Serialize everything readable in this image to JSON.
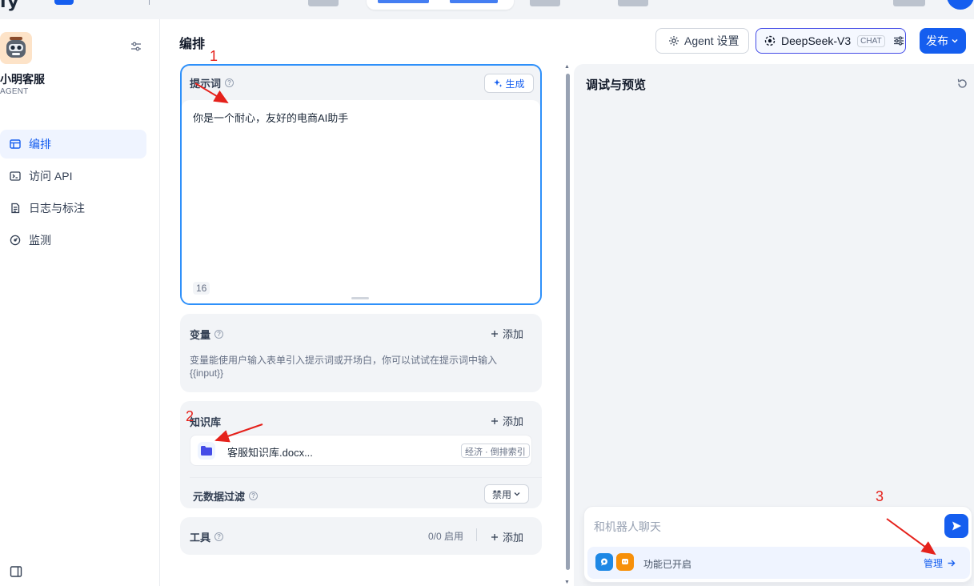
{
  "app": {
    "name": "小明客服",
    "type": "AGENT"
  },
  "sidebar": {
    "items": [
      {
        "label": "编排",
        "icon": "layout-icon",
        "active": true
      },
      {
        "label": "访问 API",
        "icon": "terminal-icon",
        "active": false
      },
      {
        "label": "日志与标注",
        "icon": "document-icon",
        "active": false
      },
      {
        "label": "监测",
        "icon": "gauge-icon",
        "active": false
      }
    ]
  },
  "header": {
    "title": "编排",
    "agent_settings_label": "Agent 设置",
    "model_name": "DeepSeek-V3",
    "model_tag": "CHAT",
    "publish_label": "发布"
  },
  "prompt": {
    "title": "提示词",
    "generate_label": "生成",
    "text": "你是一个耐心，友好的电商AI助手",
    "char_count": "16"
  },
  "variables": {
    "title": "变量",
    "add_label": "添加",
    "description": "变量能使用户输入表单引入提示词或开场白，你可以试试在提示词中输入 {{input}}"
  },
  "knowledge": {
    "title": "知识库",
    "add_label": "添加",
    "item_name": "客服知识库.docx...",
    "item_tag": "经济 · 倒排索引"
  },
  "metadata_filter": {
    "title": "元数据过滤",
    "value": "禁用"
  },
  "tools": {
    "title": "工具",
    "count": "0/0 启用",
    "add_label": "添加"
  },
  "preview": {
    "title": "调试与预览",
    "input_placeholder": "和机器人聊天",
    "features_text": "功能已开启",
    "manage_label": "管理"
  },
  "annotations": [
    "1",
    "2",
    "3"
  ],
  "colors": {
    "accent": "#155eef",
    "focus_border": "#2e90fa",
    "annotation": "#e5211b"
  }
}
